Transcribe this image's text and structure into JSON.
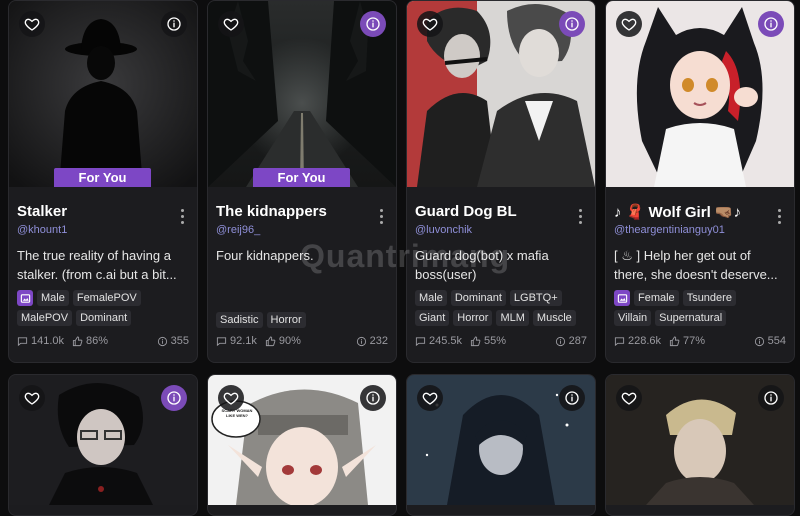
{
  "cards": [
    {
      "name": "Stalker",
      "author": "@khount1",
      "desc_lines": [
        "The true reality of having a",
        "stalker. (from c.ai but a bit..."
      ],
      "badge": "For You",
      "tag_rows": [
        [
          "Male",
          "FemalePOV"
        ],
        [
          "MalePOV",
          "Dominant"
        ]
      ],
      "has_image_tag": true,
      "chats": "141.0k",
      "likes": "86%",
      "views": "355",
      "info_style": "dark"
    },
    {
      "name": "The kidnappers",
      "author": "@reij96_",
      "desc_lines": [
        "Four kidnappers."
      ],
      "badge": "For You",
      "tag_rows": [
        [
          "Sadistic",
          "Horror"
        ]
      ],
      "has_image_tag": false,
      "chats": "92.1k",
      "likes": "90%",
      "views": "232",
      "info_style": "purple"
    },
    {
      "name": "Guard Dog BL",
      "author": "@luvonchik",
      "desc_lines": [
        "Guard dog(bot) x mafia",
        "boss(user)"
      ],
      "badge": "",
      "tag_rows": [
        [
          "Male",
          "Dominant",
          "LGBTQ+"
        ],
        [
          "Giant",
          "Horror",
          "MLM",
          "Muscle"
        ]
      ],
      "has_image_tag": false,
      "chats": "245.5k",
      "likes": "55%",
      "views": "287",
      "info_style": "purple"
    },
    {
      "name": "♪ 🧣 Wolf Girl 🤜🏽♪",
      "author": "@theargentinianguy01",
      "desc_lines": [
        "[ ♨ ] Help her get out of",
        "there, she doesn't deserve..."
      ],
      "badge": "",
      "tag_rows": [
        [
          "Female",
          "Tsundere"
        ],
        [
          "Villain",
          "Supernatural"
        ]
      ],
      "has_image_tag": true,
      "chats": "228.6k",
      "likes": "77%",
      "views": "554",
      "info_style": "purple"
    }
  ],
  "bottom_cards": [
    {
      "info_style": "purple"
    },
    {
      "info_style": "dark",
      "speech": [
        "SCARY WOMAN",
        "LIKE WEN?"
      ]
    },
    {
      "info_style": "dark"
    },
    {
      "info_style": "dark"
    }
  ],
  "watermark": "Quantrimang"
}
